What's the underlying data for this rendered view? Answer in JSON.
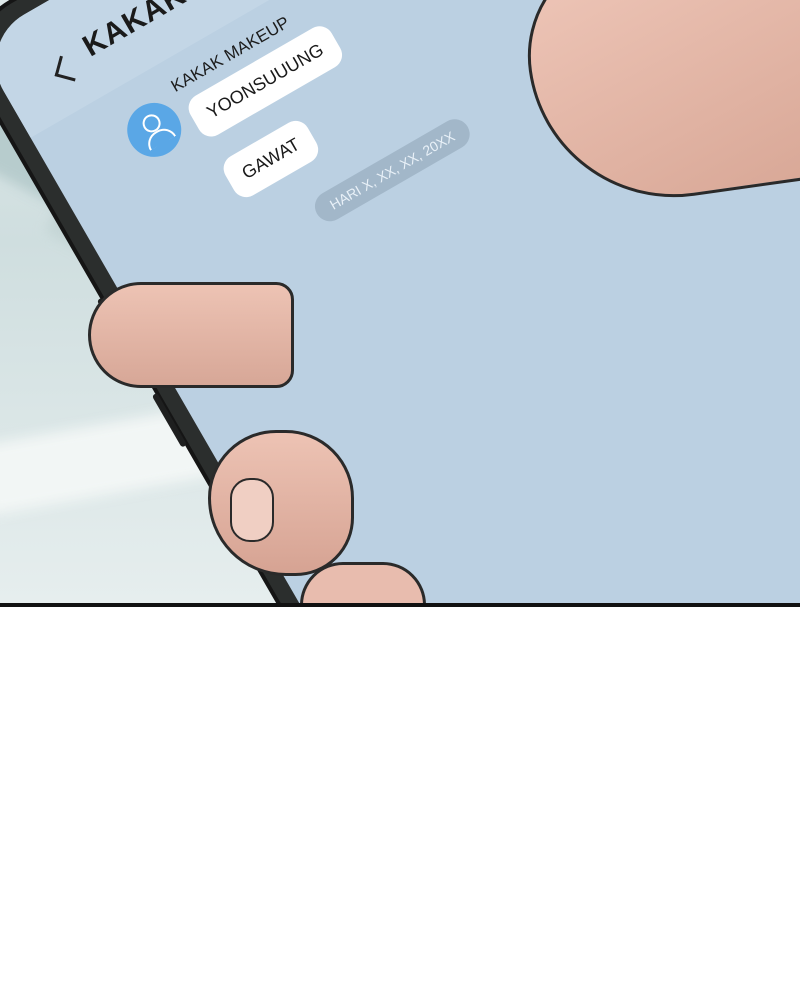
{
  "chat": {
    "title": "KAKAK MAKEUP",
    "sender_name": "KAKAK MAKEUP",
    "messages": [
      {
        "text": "YOONSUUUNG"
      },
      {
        "text": "GAWAT"
      }
    ],
    "date_label": "HARI X, XX, XX, 20XX"
  },
  "icons": {
    "back": "back-chevron-icon",
    "avatar": "user-avatar-icon"
  },
  "colors": {
    "screen_background": "#bbd0e2",
    "avatar": "#5aa7e6",
    "bubble": "#ffffff",
    "date_pill": "#a2b7c9"
  }
}
